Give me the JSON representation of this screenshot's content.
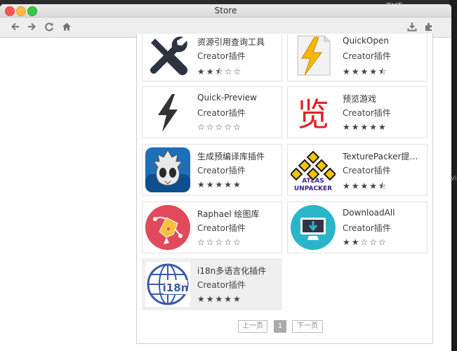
{
  "window": {
    "title": "Store"
  },
  "background": {
    "text_top": "TXT",
    "text_side": "Vic"
  },
  "cards": [
    {
      "name": "资源引用查询工具",
      "sub": "Creator插件",
      "stars": "★★⯪☆☆",
      "icon": "tools-icon"
    },
    {
      "name": "QuickOpen",
      "sub": "Creator插件",
      "stars": "★★★★⯪",
      "icon": "lightning-file-icon"
    },
    {
      "name": "Quick-Preview",
      "sub": "Creator插件",
      "stars": "☆☆☆☆☆",
      "icon": "bolt-icon"
    },
    {
      "name": "预览游戏",
      "sub": "Creator插件",
      "stars": "★★★★★",
      "icon": "preview-logo-icon"
    },
    {
      "name": "生成预编译库插件",
      "sub": "Creator插件",
      "stars": "★★★★★",
      "icon": "cocos-mascot-icon"
    },
    {
      "name": "TexturePacker提取…",
      "sub": "Creator插件",
      "stars": "★★★★⯪",
      "icon": "atlas-unpacker-icon"
    },
    {
      "name": "Raphael 绘图库",
      "sub": "Creator插件",
      "stars": "☆☆☆☆☆",
      "icon": "pen-tool-icon"
    },
    {
      "name": "DownloadAll",
      "sub": "Creator插件",
      "stars": "★★☆☆☆",
      "icon": "download-monitor-icon"
    },
    {
      "name": "i18n多语言化插件",
      "sub": "Creator插件",
      "stars": "★★★★★",
      "icon": "globe-i18n-icon"
    }
  ],
  "icon_text": {
    "atlas": "ATLAS",
    "unpacker": "UNPACKER",
    "i18n": "i18n",
    "preview": "览"
  },
  "pager": {
    "prev": "上一页",
    "page": "1",
    "next": "下一页"
  },
  "colors": {
    "pen_bg": "#e04a5a",
    "download_bg": "#2bb5c9",
    "cocos_bg": "#1d6fb8"
  }
}
